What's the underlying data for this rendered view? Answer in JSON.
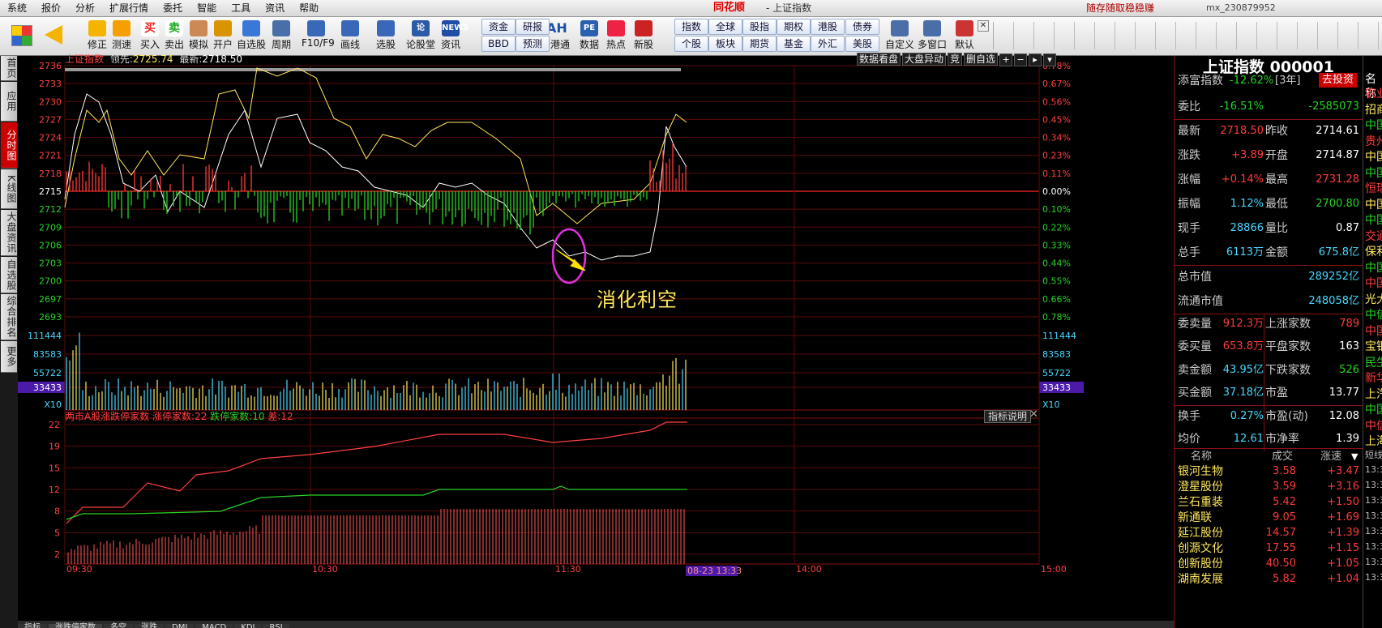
{
  "menu": [
    "系统",
    "报价",
    "分析",
    "扩展行情",
    "委托",
    "智能",
    "工具",
    "资讯",
    "帮助"
  ],
  "brand": "同花顺",
  "window_title": "- 上证指数",
  "slogan": "随存随取稳稳赚",
  "user_id": "mx_230879952",
  "toolbar": {
    "big": [
      {
        "label": "修正",
        "icon": "up-down-icon"
      },
      {
        "label": "测速",
        "icon": "speed-icon"
      },
      {
        "label": "买入",
        "icon": "buy-icon"
      },
      {
        "label": "卖出",
        "icon": "sell-icon"
      },
      {
        "label": "模拟",
        "icon": "hammer-icon"
      },
      {
        "label": "开户",
        "icon": "lock-icon"
      },
      {
        "label": "自选股",
        "icon": "star-icon"
      },
      {
        "label": "周期",
        "icon": "clock-icon"
      },
      {
        "label": "F10/F9",
        "icon": "f10-icon"
      },
      {
        "label": "画线",
        "icon": "pen-icon"
      },
      {
        "label": "选股",
        "icon": "screen-icon"
      },
      {
        "label": "论股堂",
        "icon": "lun-icon"
      },
      {
        "label": "资讯",
        "icon": "news-icon"
      },
      {
        "label": "陆港通",
        "icon": "ah-icon"
      },
      {
        "label": "数据",
        "icon": "pe-icon"
      },
      {
        "label": "热点",
        "icon": "hot-icon"
      },
      {
        "label": "新股",
        "icon": "newstock-icon"
      },
      {
        "label": "自定义",
        "icon": "custom-icon"
      },
      {
        "label": "多窗口",
        "icon": "multiwin-icon"
      },
      {
        "label": "默认",
        "icon": "home-icon"
      }
    ],
    "icon_text": {
      "sell": "卖",
      "buy": "买",
      "lun": "论",
      "news": "NEWS",
      "ah": "AH",
      "pe": "PE"
    },
    "small": [
      {
        "top": "资金",
        "bottom": "BBD"
      },
      {
        "top": "研报",
        "bottom": "预测"
      },
      {
        "top": "指数",
        "bottom": "个股"
      },
      {
        "top": "全球",
        "bottom": "板块"
      },
      {
        "top": "股指",
        "bottom": "期货"
      },
      {
        "top": "期权",
        "bottom": "基金"
      },
      {
        "top": "港股",
        "bottom": "外汇"
      },
      {
        "top": "债券",
        "bottom": "美股"
      }
    ]
  },
  "left_tabs": [
    "首页",
    "应用",
    "分时图",
    "K线图",
    "大盘资讯",
    "自选股",
    "综合排名",
    "更多"
  ],
  "chart_header": {
    "name": "上证指数",
    "lead_label": "领先:",
    "lead_value": "2725.74",
    "latest_label": "最新:",
    "latest_value": "2718.50"
  },
  "chart_buttons": [
    "数据看盘",
    "大盘异动",
    "竞",
    "删自选"
  ],
  "price_axis": [
    "2736",
    "2733",
    "2730",
    "2727",
    "2724",
    "2721",
    "2718",
    "2715",
    "2712",
    "2709",
    "2706",
    "2703",
    "2700",
    "2697",
    "2693"
  ],
  "pct_axis": [
    "0.78%",
    "0.67%",
    "0.56%",
    "0.45%",
    "0.34%",
    "0.23%",
    "0.11%",
    "0.00%",
    "0.10%",
    "0.22%",
    "0.33%",
    "0.44%",
    "0.55%",
    "0.66%",
    "0.78%"
  ],
  "volume_axis": [
    "111444",
    "83583",
    "55722",
    "33433"
  ],
  "volume_multiplier": "X10",
  "annotation": "消化利空",
  "limit_panel": {
    "title": "两市A股涨跌停家数",
    "up_label": "涨停家数:",
    "up_value": "22",
    "down_label": "跌停家数:",
    "down_value": "10",
    "diff_label": "差:",
    "diff_value": "12",
    "help": "指标说明",
    "axis": [
      "22",
      "19",
      "15",
      "12",
      "8",
      "5",
      "2"
    ]
  },
  "time_axis": [
    "09:30",
    "10:30",
    "11:30",
    "14:00",
    "15:00"
  ],
  "cursor_time": "08-23 13:33",
  "chart_data": {
    "type": "line",
    "x_range": [
      "09:30",
      "15:00"
    ],
    "y_axis_prices": [
      2693,
      2736
    ],
    "prev_close": 2714.61,
    "series": [],
    "limit_counts": {
      "up": 22,
      "down": 10
    }
  },
  "right_panel": {
    "title": "上证指数 000001",
    "tianfu_label": "添富指数",
    "tianfu_value": "-12.62%",
    "tianfu_period": "[3年]",
    "invest_btn": "去投资",
    "rows": [
      {
        "l": "委比",
        "v": "-16.51%",
        "v2": "-2585073"
      },
      {
        "l": "最新",
        "v": "2718.50",
        "l2": "昨收",
        "v2": "2714.61"
      },
      {
        "l": "涨跌",
        "v": "+3.89",
        "l2": "开盘",
        "v2": "2714.87"
      },
      {
        "l": "涨幅",
        "v": "+0.14%",
        "l2": "最高",
        "v2": "2731.28"
      },
      {
        "l": "振幅",
        "v": "1.12%",
        "l2": "最低",
        "v2": "2700.80"
      },
      {
        "l": "现手",
        "v": "28866",
        "l2": "量比",
        "v2": "0.87"
      },
      {
        "l": "总手",
        "v": "6113万",
        "l2": "金额",
        "v2": "675.8亿"
      },
      {
        "l": "总市值",
        "v": "289252亿"
      },
      {
        "l": "流通市值",
        "v": "248058亿"
      },
      {
        "l": "委卖量",
        "v": "912.3万",
        "l2": "上涨家数",
        "v2": "789"
      },
      {
        "l": "委买量",
        "v": "653.8万",
        "l2": "平盘家数",
        "v2": "163"
      },
      {
        "l": "卖金额",
        "v": "43.95亿",
        "l2": "下跌家数",
        "v2": "526"
      },
      {
        "l": "买金额",
        "v": "37.18亿",
        "l2": "市盈",
        "v2": "13.77"
      },
      {
        "l": "换手",
        "v": "0.27%",
        "l2": "市盈(动)",
        "v2": "12.08"
      },
      {
        "l": "均价",
        "v": "12.61",
        "l2": "市净率",
        "v2": "1.39"
      }
    ],
    "list_headers": [
      "名称",
      "成交",
      "涨速"
    ],
    "list": [
      {
        "n": "银河生物",
        "p": "3.58",
        "s": "+3.47"
      },
      {
        "n": "澄星股份",
        "p": "3.59",
        "s": "+3.16"
      },
      {
        "n": "兰石重装",
        "p": "5.42",
        "s": "+1.50"
      },
      {
        "n": "新通联",
        "p": "9.05",
        "s": "+1.69"
      },
      {
        "n": "延江股份",
        "p": "14.57",
        "s": "+1.39"
      },
      {
        "n": "创源文化",
        "p": "17.55",
        "s": "+1.15"
      },
      {
        "n": "创新股份",
        "p": "40.50",
        "s": "+1.05"
      },
      {
        "n": "湖南发展",
        "p": "5.82",
        "s": "+1.04"
      }
    ]
  },
  "far_right": {
    "header": "名称",
    "items": [
      "农业",
      "招商",
      "中国",
      "贵州",
      "中国",
      "中国",
      "恒瑞",
      "中国",
      "中国",
      "交通",
      "保利",
      "中国",
      "中国",
      "光大",
      "中信",
      "中国",
      "宝钢",
      "民生",
      "新华",
      "上汽",
      "中国",
      "中信",
      "上海"
    ],
    "tail": "短线",
    "times": [
      "13:3",
      "13:3",
      "13:3",
      "13:3",
      "13:3",
      "13:3",
      "13:3",
      "13:3"
    ]
  },
  "bottom_tabs": [
    "指标",
    "涨跌停家数",
    "多空",
    "涨跌",
    "DMI",
    "MACD",
    "KDJ",
    "RSI"
  ]
}
